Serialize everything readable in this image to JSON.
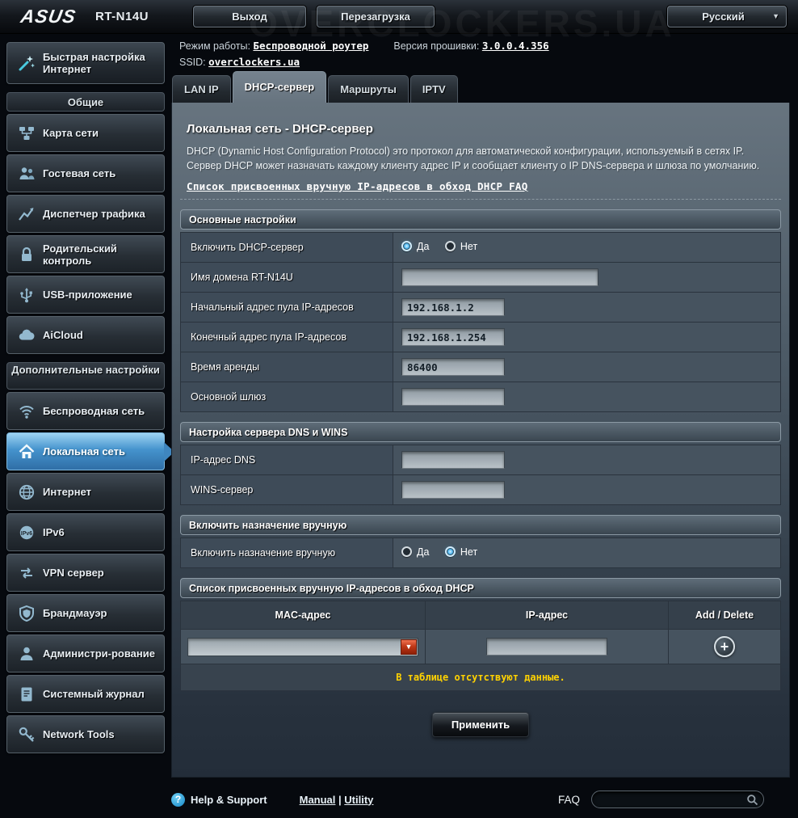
{
  "watermark": "OVERCLOCKERS.UA",
  "topbar": {
    "brand": "ASUS",
    "model": "RT-N14U",
    "logout": "Выход",
    "reboot": "Перезагрузка",
    "language": "Русский"
  },
  "icons": {
    "caret_down": "▼",
    "add": "+",
    "help": "?"
  },
  "status": {
    "mode_label": "Режим работы:",
    "mode_value": "Беспроводной роутер",
    "firmware_label": "Версия прошивки:",
    "firmware_value": "3.0.0.4.356",
    "ssid_label": "SSID:",
    "ssid_value": "overclockers.ua"
  },
  "sidebar": {
    "quick_setup": "Быстрая настройка Интернет",
    "sections": [
      {
        "header": "Общие",
        "items": [
          {
            "label": "Карта сети",
            "icon": "network-map-icon"
          },
          {
            "label": "Гостевая сеть",
            "icon": "guest-network-icon"
          },
          {
            "label": "Диспетчер трафика",
            "icon": "traffic-manager-icon"
          },
          {
            "label": "Родительский контроль",
            "icon": "parental-control-icon"
          },
          {
            "label": "USB-приложение",
            "icon": "usb-application-icon"
          },
          {
            "label": "AiCloud",
            "icon": "aicloud-icon"
          }
        ]
      },
      {
        "header": "Дополнительные настройки",
        "items": [
          {
            "label": "Беспроводная сеть",
            "icon": "wireless-icon"
          },
          {
            "label": "Локальная сеть",
            "icon": "lan-icon",
            "active": true
          },
          {
            "label": "Интернет",
            "icon": "internet-icon"
          },
          {
            "label": "IPv6",
            "icon": "ipv6-icon"
          },
          {
            "label": "VPN сервер",
            "icon": "vpn-icon"
          },
          {
            "label": "Брандмауэр",
            "icon": "firewall-icon"
          },
          {
            "label": "Администри-рование",
            "icon": "administration-icon"
          },
          {
            "label": "Системный журнал",
            "icon": "system-log-icon"
          },
          {
            "label": "Network Tools",
            "icon": "network-tools-icon"
          }
        ]
      }
    ]
  },
  "tabs": [
    {
      "label": "LAN IP"
    },
    {
      "label": "DHCP-сервер",
      "active": true
    },
    {
      "label": "Маршруты"
    },
    {
      "label": "IPTV"
    }
  ],
  "page": {
    "title": "Локальная сеть - DHCP-сервер",
    "description": "DHCP (Dynamic Host Configuration Protocol) это протокол для автоматической конфигурации, используемый в сетях IP. Сервер DHCP может назначать каждому клиенту адрес IP и сообщает клиенту о IP DNS-сервера и шлюза по умолчанию.",
    "faq_link": "Список присвоенных вручную IP-адресов в обход DHCP FAQ"
  },
  "basic": {
    "header": "Основные настройки",
    "dhcp_enable": {
      "label": "Включить DHCP-сервер",
      "yes": "Да",
      "no": "Нет",
      "selected": "Да"
    },
    "domain": {
      "label": "Имя домена RT-N14U",
      "value": ""
    },
    "pool_start": {
      "label": "Начальный адрес пула IP-адресов",
      "value": "192.168.1.2"
    },
    "pool_end": {
      "label": "Конечный адрес пула IP-адресов",
      "value": "192.168.1.254"
    },
    "lease": {
      "label": "Время аренды",
      "value": "86400"
    },
    "gateway": {
      "label": "Основной шлюз",
      "value": ""
    }
  },
  "dns": {
    "header": "Настройка сервера DNS и WINS",
    "dns_ip": {
      "label": "IP-адрес DNS",
      "value": ""
    },
    "wins": {
      "label": "WINS-сервер",
      "value": ""
    }
  },
  "manual": {
    "header": "Включить назначение вручную",
    "enable_label": "Включить назначение вручную",
    "yes": "Да",
    "no": "Нет",
    "selected": "Нет"
  },
  "manual_list": {
    "header": "Список присвоенных вручную IP-адресов в обход DHCP",
    "col_mac": "MAC-адрес",
    "col_ip": "IP-адрес",
    "col_add": "Add / Delete",
    "ip_value": "",
    "empty_text": "В таблице отсутствуют данные."
  },
  "apply_label": "Применить",
  "footer": {
    "help": "Help & Support",
    "manual": "Manual",
    "separator": "|",
    "utility": "Utility",
    "faq": "FAQ"
  },
  "colors": {
    "accent_blue": "#4593cd",
    "warning_yellow": "#ffd200",
    "dropdown_red": "#c03818"
  }
}
